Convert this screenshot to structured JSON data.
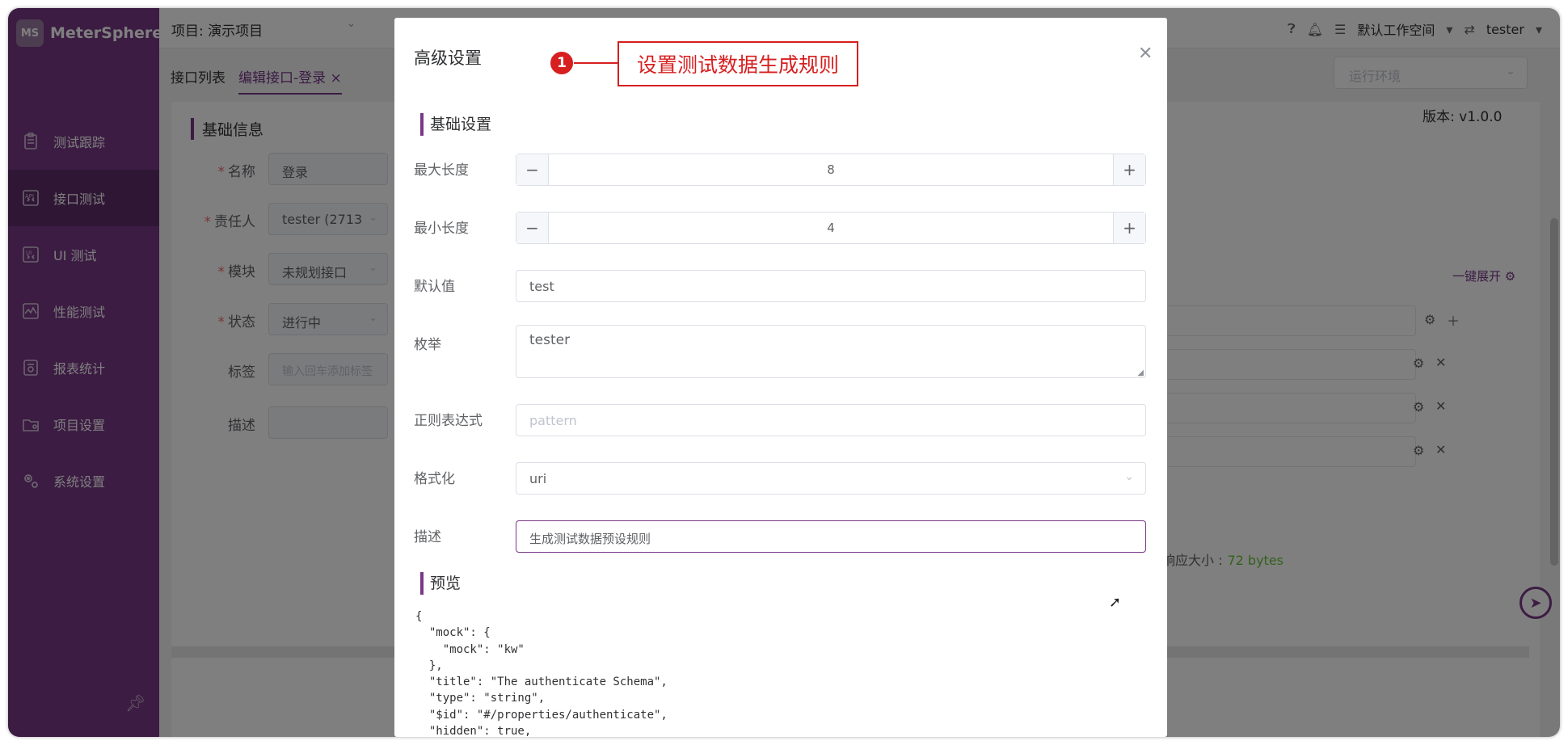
{
  "app": {
    "name": "MeterSphere",
    "logo_mark": "MS"
  },
  "header": {
    "project": "项目: 演示项目",
    "workspace": "默认工作空间",
    "user": "tester"
  },
  "sidebar": {
    "items": [
      {
        "label": "测试跟踪",
        "icon": "clipboard-icon"
      },
      {
        "label": "接口测试",
        "icon": "api-icon"
      },
      {
        "label": "UI 测试",
        "icon": "ui-icon"
      },
      {
        "label": "性能测试",
        "icon": "performance-chart-icon"
      },
      {
        "label": "报表统计",
        "icon": "report-icon"
      },
      {
        "label": "项目设置",
        "icon": "folder-icon"
      },
      {
        "label": "系统设置",
        "icon": "gears-icon"
      }
    ],
    "active_index": 1
  },
  "tabs": [
    {
      "label": "接口列表"
    },
    {
      "label": "编辑接口-登录"
    }
  ],
  "env_select": {
    "placeholder": "运行环境"
  },
  "basic_info": {
    "title": "基础信息",
    "fields": [
      {
        "label": "名称",
        "value": "登录",
        "required": true
      },
      {
        "label": "责任人",
        "value": "tester (2713",
        "required": true
      },
      {
        "label": "模块",
        "value": "未规划接口",
        "required": true
      },
      {
        "label": "状态",
        "value": "进行中",
        "required": true
      },
      {
        "label": "标签",
        "placeholder": "输入回车添加标签",
        "required": false
      },
      {
        "label": "描述",
        "value": "",
        "required": false
      }
    ],
    "version": "版本: v1.0.0",
    "expand_all": "一键展开",
    "response_size_label": "响应大小 :",
    "response_size_value": "72 bytes"
  },
  "dialog": {
    "title": "高级设置",
    "basic_section": "基础设置",
    "max_length": {
      "label": "最大长度",
      "value": "8"
    },
    "min_length": {
      "label": "最小长度",
      "value": "4"
    },
    "default_value": {
      "label": "默认值",
      "value": "test"
    },
    "enum": {
      "label": "枚举",
      "value": "tester"
    },
    "regex": {
      "label": "正则表达式",
      "placeholder": "pattern"
    },
    "format": {
      "label": "格式化",
      "value": "uri"
    },
    "description": {
      "label": "描述",
      "value": "生成测试数据预设规则"
    },
    "preview_section": "预览",
    "preview_text": "{\n  \"mock\": {\n    \"mock\": \"kw\"\n  },\n  \"title\": \"The authenticate Schema\",\n  \"type\": \"string\",\n  \"$id\": \"#/properties/authenticate\",\n  \"hidden\": true,\n  \"pattern\": \"\""
  },
  "annotation": {
    "number": "1",
    "text": "设置测试数据生成规则",
    "color": "#d71f1f"
  },
  "colors": {
    "brand": "#783887",
    "brand_dark": "#5e2c6a"
  }
}
